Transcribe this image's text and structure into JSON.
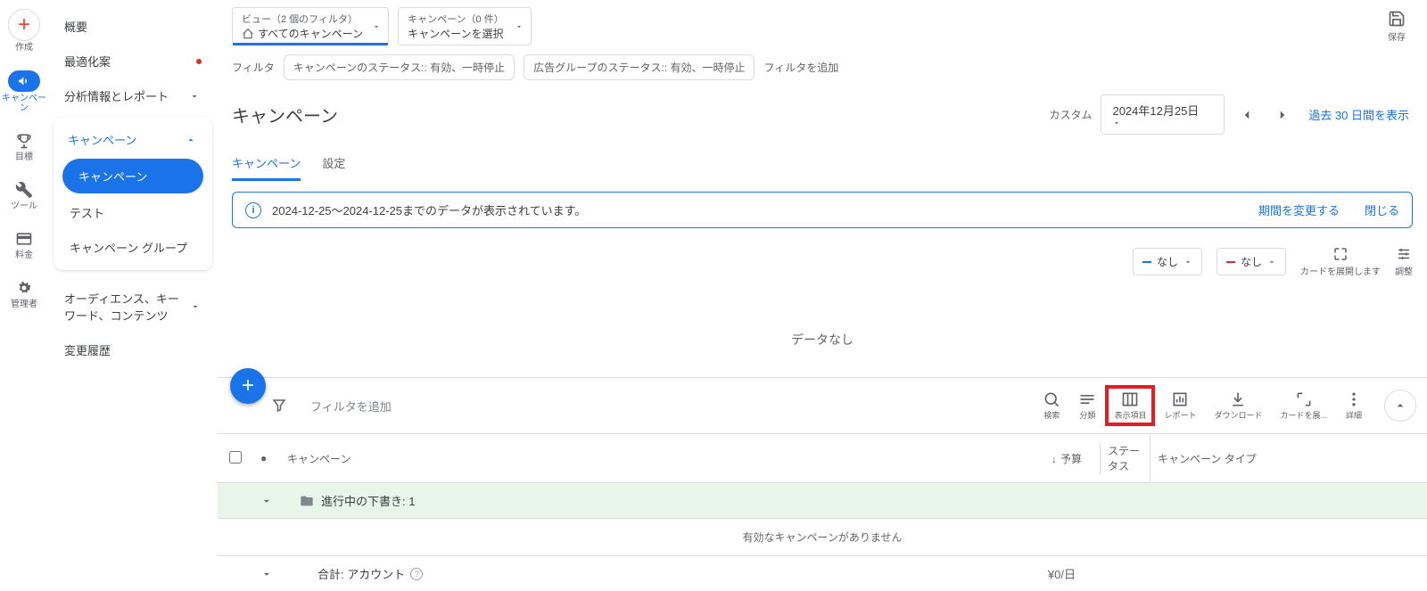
{
  "rail": {
    "create": "作成",
    "campaign": "キャンペーン",
    "goal": "目標",
    "tool": "ツール",
    "billing": "料金",
    "admin": "管理者"
  },
  "nav": {
    "overview": "概要",
    "optimization": "最適化案",
    "insights": "分析情報とレポート",
    "campaign_hdr": "キャンペーン",
    "campaign": "キャンペーン",
    "test": "テスト",
    "campaign_group": "キャンペーン グループ",
    "audience": "オーディエンス、キーワード、コンテンツ",
    "history": "変更履歴"
  },
  "top": {
    "view_l1": "ビュー（2 個のフィルタ）",
    "view_l2": "すべてのキャンペーン",
    "camp_l1": "キャンペーン（0 件）",
    "camp_l2": "キャンペーンを選択",
    "save": "保存"
  },
  "filters": {
    "label": "フィルタ",
    "chip1": "キャンペーンのステータス:: 有効、一時停止",
    "chip2": "広告グループのステータス:: 有効、一時停止",
    "add": "フィルタを追加"
  },
  "header": {
    "title": "キャンペーン",
    "custom": "カスタム",
    "date": "2024年12月25日",
    "last30": "過去 30 日間を表示"
  },
  "tabs": {
    "campaign": "キャンペーン",
    "settings": "設定"
  },
  "notice": {
    "msg": "2024-12-25～2024-12-25までのデータが表示されています。",
    "change": "期間を変更する",
    "close": "閉じる"
  },
  "cardbar": {
    "none1": "なし",
    "none2": "なし",
    "expand": "カードを展開します",
    "adjust": "調整"
  },
  "nodata": "データなし",
  "toolbar": {
    "addfilter": "フィルタを追加",
    "search": "検索",
    "segment": "分類",
    "columns": "表示項目",
    "report": "レポート",
    "download": "ダウンロード",
    "expand": "カードを展...",
    "more": "詳細"
  },
  "table": {
    "col_campaign": "キャンペーン",
    "col_budget": "予算",
    "col_status": "ステータス",
    "col_type": "キャンペーン タイプ",
    "draft_row": "進行中の下書き: 1",
    "no_enabled": "有効なキャンペーンがありません",
    "total": "合計: アカウント",
    "total_budget": "¥0/日"
  }
}
